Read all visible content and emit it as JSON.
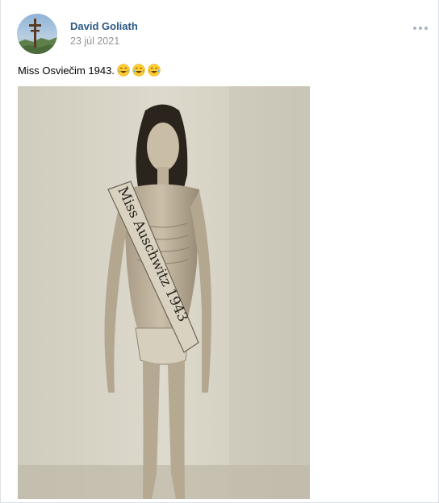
{
  "post": {
    "author": {
      "name": "David Goliath",
      "avatar_icon": "cross-landscape-avatar"
    },
    "date": "23 júl 2021",
    "text": "Miss Osviečim 1943.",
    "emojis": [
      "laughing-tears-emoji",
      "laughing-tears-emoji",
      "laughing-tears-emoji"
    ],
    "more_icon": "more-horizontal-icon",
    "image": {
      "sash_text": "Miss Auschwitz 1943"
    }
  },
  "colors": {
    "author_link": "#2a5885",
    "date_text": "#939393",
    "border": "#dce1e6",
    "more_dots": "#a8b5c4"
  }
}
